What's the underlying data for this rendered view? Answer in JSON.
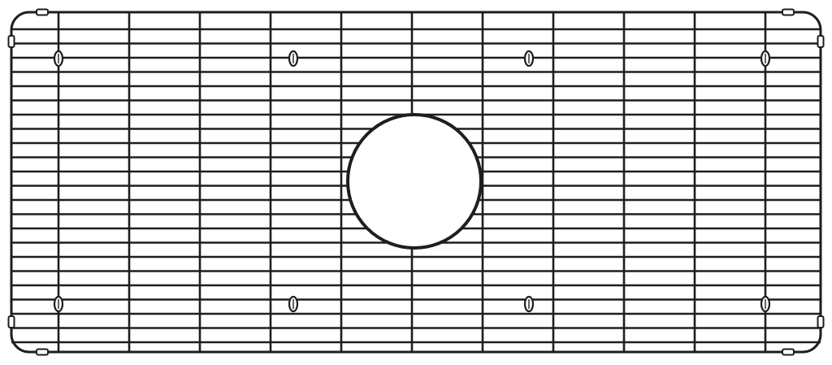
{
  "image": {
    "subject": "sink-bottom-grid",
    "colors": {
      "background": "#ffffff",
      "wire": "#1e1e1e",
      "drain_fill": "#ffffff"
    },
    "grid": {
      "vertical_wire_count": 11,
      "horizontal_wire_count": 23
    },
    "bumper_feet_count": 8,
    "corner_clips_count": 8
  }
}
